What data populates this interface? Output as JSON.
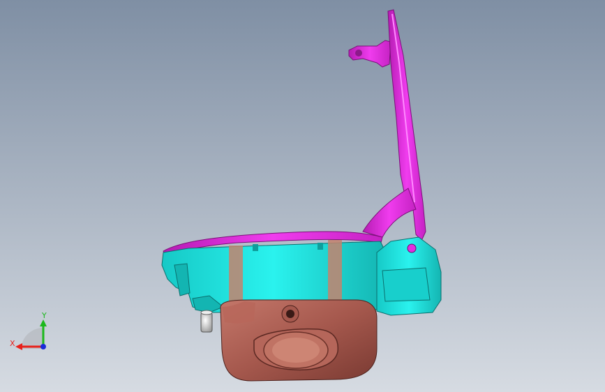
{
  "viewport": {
    "background_top": "#7f8fa4",
    "background_bottom": "#d6dbe2"
  },
  "model": {
    "parts": [
      {
        "name": "bracket-arm",
        "color": "#e22de0"
      },
      {
        "name": "housing-body",
        "color": "#1fe6e2"
      },
      {
        "name": "motor-cup",
        "color": "#a5584d"
      },
      {
        "name": "side-block",
        "color": "#1fe6e2"
      },
      {
        "name": "pin",
        "color": "#d8d8d8"
      }
    ]
  },
  "triad": {
    "x_label": "X",
    "y_label": "Y",
    "x_color": "#e8201a",
    "y_color": "#1cb81c",
    "z_color": "#1a2cd8"
  }
}
